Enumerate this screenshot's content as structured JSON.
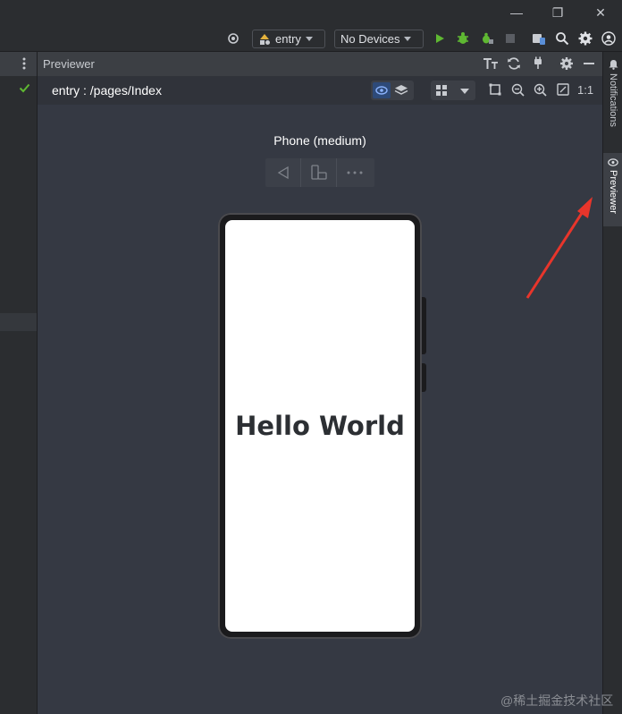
{
  "window": {
    "minimize_glyph": "—",
    "restore_glyph": "❐",
    "close_glyph": "✕"
  },
  "toolbar": {
    "run_config": "entry",
    "device": "No Devices"
  },
  "previewer": {
    "panel_title": "Previewer",
    "page_path": "entry : /pages/Index",
    "zoom_actual": "1:1"
  },
  "device_preview": {
    "device_name": "Phone (medium)",
    "screen_text": "Hello World"
  },
  "right_tabs": {
    "notifications": "Notifications",
    "previewer": "Previewer"
  },
  "watermark": "@稀土掘金技术社区",
  "colors": {
    "accent_green": "#5fb832",
    "arrow_red": "#e8352b",
    "active_blue": "#3574f0"
  }
}
